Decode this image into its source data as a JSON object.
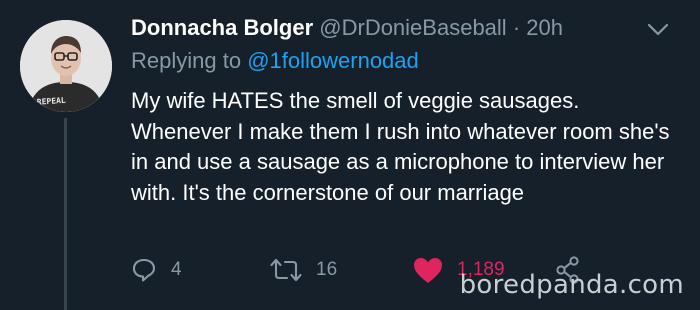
{
  "tweet": {
    "display_name": "Donnacha Bolger",
    "handle": "@DrDonieBaseball",
    "separator": "·",
    "time": "20h",
    "replying_prefix": "Replying to",
    "replying_to": "@1followernodad",
    "text": "My wife HATES the smell of veggie sausages. Whenever I make them I rush into whatever room she's in and use a sausage as a microphone to interview her with. It's the cornerstone of our marriage"
  },
  "avatar": {
    "shirt_text": "REPEAL"
  },
  "actions": {
    "reply_count": "4",
    "retweet_count": "16",
    "like_count": "1,189"
  },
  "watermark": {
    "text": "boredpanda.com"
  },
  "colors": {
    "background": "#15202b",
    "secondary_text": "#8899a6",
    "link": "#1da1f2",
    "like": "#e0245e"
  },
  "icons": {
    "menu": "chevron-down-icon",
    "reply": "reply-icon",
    "retweet": "retweet-icon",
    "like": "heart-icon",
    "share": "share-icon"
  }
}
